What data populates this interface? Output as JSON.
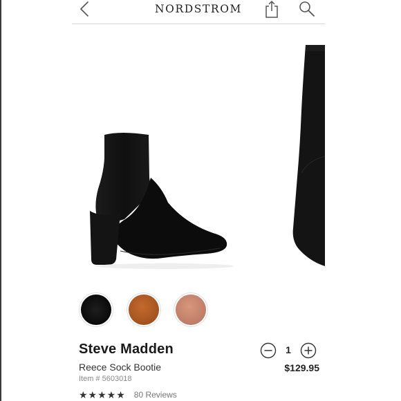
{
  "header": {
    "brand": "NORDSTROM",
    "back_icon": "chevron-left-icon",
    "share_icon": "share-icon",
    "search_icon": "search-icon"
  },
  "gallery": {
    "images": [
      "boot-side-view",
      "boot-detail-closeup"
    ]
  },
  "swatches": [
    {
      "name": "black",
      "color": "#0f0f0f",
      "selected": true
    },
    {
      "name": "cognac",
      "color": "#a4521e",
      "selected": false
    },
    {
      "name": "blush",
      "color": "#c07c66",
      "selected": false
    }
  ],
  "product": {
    "brand": "Steve Madden",
    "name": "Reece Sock Bootie",
    "item_number": "Item # 5603018",
    "rating_stars": "★★★★★",
    "rating_value": 4.5,
    "reviews": "80 Reviews",
    "price": "$129.95"
  },
  "quantity": {
    "value": "1",
    "minus_icon": "minus-circle-icon",
    "plus_icon": "plus-circle-icon"
  }
}
